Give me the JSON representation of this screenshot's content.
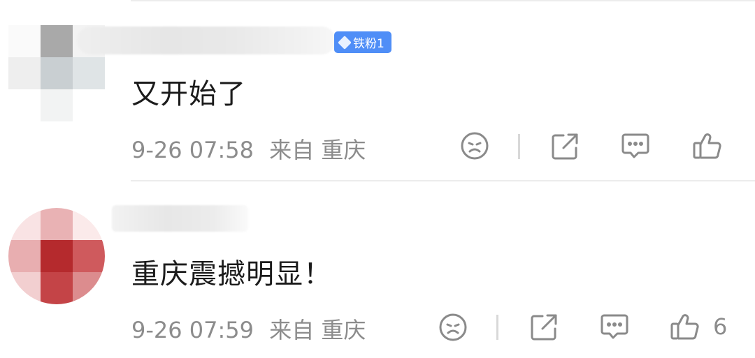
{
  "comments": [
    {
      "badge": "铁粉1",
      "text": "又开始了",
      "date": "9-26 07:58",
      "location": "来自 重庆",
      "like_count": ""
    },
    {
      "badge": "",
      "text": "重庆震撼明显！",
      "date": "9-26 07:59",
      "location": "来自 重庆",
      "like_count": "6"
    }
  ],
  "colors": {
    "badge_bg": "#4f8ef7",
    "meta_text": "#8c8c8c",
    "icon_stroke": "#8a8a8a"
  },
  "icons": [
    "sad-face-icon",
    "share-icon",
    "comment-icon",
    "thumbs-up-icon"
  ]
}
